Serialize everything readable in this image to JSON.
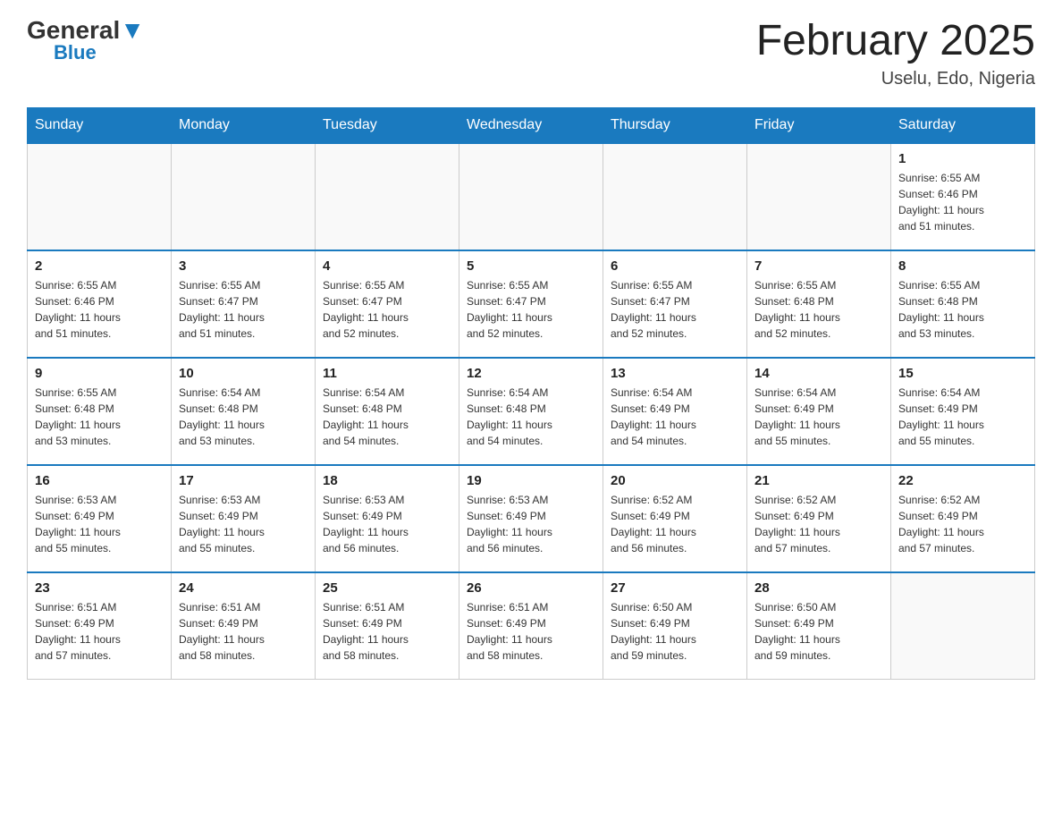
{
  "header": {
    "logo_general": "General",
    "logo_blue": "Blue",
    "month_title": "February 2025",
    "location": "Uselu, Edo, Nigeria"
  },
  "weekdays": [
    "Sunday",
    "Monday",
    "Tuesday",
    "Wednesday",
    "Thursday",
    "Friday",
    "Saturday"
  ],
  "weeks": [
    [
      {
        "day": "",
        "info": ""
      },
      {
        "day": "",
        "info": ""
      },
      {
        "day": "",
        "info": ""
      },
      {
        "day": "",
        "info": ""
      },
      {
        "day": "",
        "info": ""
      },
      {
        "day": "",
        "info": ""
      },
      {
        "day": "1",
        "info": "Sunrise: 6:55 AM\nSunset: 6:46 PM\nDaylight: 11 hours\nand 51 minutes."
      }
    ],
    [
      {
        "day": "2",
        "info": "Sunrise: 6:55 AM\nSunset: 6:46 PM\nDaylight: 11 hours\nand 51 minutes."
      },
      {
        "day": "3",
        "info": "Sunrise: 6:55 AM\nSunset: 6:47 PM\nDaylight: 11 hours\nand 51 minutes."
      },
      {
        "day": "4",
        "info": "Sunrise: 6:55 AM\nSunset: 6:47 PM\nDaylight: 11 hours\nand 52 minutes."
      },
      {
        "day": "5",
        "info": "Sunrise: 6:55 AM\nSunset: 6:47 PM\nDaylight: 11 hours\nand 52 minutes."
      },
      {
        "day": "6",
        "info": "Sunrise: 6:55 AM\nSunset: 6:47 PM\nDaylight: 11 hours\nand 52 minutes."
      },
      {
        "day": "7",
        "info": "Sunrise: 6:55 AM\nSunset: 6:48 PM\nDaylight: 11 hours\nand 52 minutes."
      },
      {
        "day": "8",
        "info": "Sunrise: 6:55 AM\nSunset: 6:48 PM\nDaylight: 11 hours\nand 53 minutes."
      }
    ],
    [
      {
        "day": "9",
        "info": "Sunrise: 6:55 AM\nSunset: 6:48 PM\nDaylight: 11 hours\nand 53 minutes."
      },
      {
        "day": "10",
        "info": "Sunrise: 6:54 AM\nSunset: 6:48 PM\nDaylight: 11 hours\nand 53 minutes."
      },
      {
        "day": "11",
        "info": "Sunrise: 6:54 AM\nSunset: 6:48 PM\nDaylight: 11 hours\nand 54 minutes."
      },
      {
        "day": "12",
        "info": "Sunrise: 6:54 AM\nSunset: 6:48 PM\nDaylight: 11 hours\nand 54 minutes."
      },
      {
        "day": "13",
        "info": "Sunrise: 6:54 AM\nSunset: 6:49 PM\nDaylight: 11 hours\nand 54 minutes."
      },
      {
        "day": "14",
        "info": "Sunrise: 6:54 AM\nSunset: 6:49 PM\nDaylight: 11 hours\nand 55 minutes."
      },
      {
        "day": "15",
        "info": "Sunrise: 6:54 AM\nSunset: 6:49 PM\nDaylight: 11 hours\nand 55 minutes."
      }
    ],
    [
      {
        "day": "16",
        "info": "Sunrise: 6:53 AM\nSunset: 6:49 PM\nDaylight: 11 hours\nand 55 minutes."
      },
      {
        "day": "17",
        "info": "Sunrise: 6:53 AM\nSunset: 6:49 PM\nDaylight: 11 hours\nand 55 minutes."
      },
      {
        "day": "18",
        "info": "Sunrise: 6:53 AM\nSunset: 6:49 PM\nDaylight: 11 hours\nand 56 minutes."
      },
      {
        "day": "19",
        "info": "Sunrise: 6:53 AM\nSunset: 6:49 PM\nDaylight: 11 hours\nand 56 minutes."
      },
      {
        "day": "20",
        "info": "Sunrise: 6:52 AM\nSunset: 6:49 PM\nDaylight: 11 hours\nand 56 minutes."
      },
      {
        "day": "21",
        "info": "Sunrise: 6:52 AM\nSunset: 6:49 PM\nDaylight: 11 hours\nand 57 minutes."
      },
      {
        "day": "22",
        "info": "Sunrise: 6:52 AM\nSunset: 6:49 PM\nDaylight: 11 hours\nand 57 minutes."
      }
    ],
    [
      {
        "day": "23",
        "info": "Sunrise: 6:51 AM\nSunset: 6:49 PM\nDaylight: 11 hours\nand 57 minutes."
      },
      {
        "day": "24",
        "info": "Sunrise: 6:51 AM\nSunset: 6:49 PM\nDaylight: 11 hours\nand 58 minutes."
      },
      {
        "day": "25",
        "info": "Sunrise: 6:51 AM\nSunset: 6:49 PM\nDaylight: 11 hours\nand 58 minutes."
      },
      {
        "day": "26",
        "info": "Sunrise: 6:51 AM\nSunset: 6:49 PM\nDaylight: 11 hours\nand 58 minutes."
      },
      {
        "day": "27",
        "info": "Sunrise: 6:50 AM\nSunset: 6:49 PM\nDaylight: 11 hours\nand 59 minutes."
      },
      {
        "day": "28",
        "info": "Sunrise: 6:50 AM\nSunset: 6:49 PM\nDaylight: 11 hours\nand 59 minutes."
      },
      {
        "day": "",
        "info": ""
      }
    ]
  ]
}
